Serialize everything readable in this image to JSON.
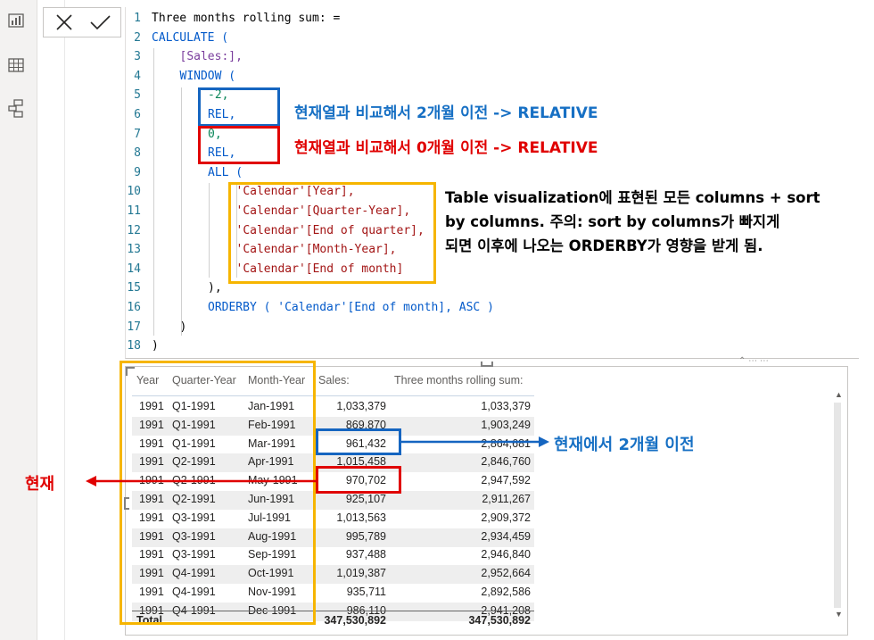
{
  "formula_bar": {
    "cancel_icon": "close-icon",
    "commit_icon": "checkmark-icon",
    "lines": [
      {
        "n": "1",
        "text": "Three months rolling sum: ="
      },
      {
        "n": "2",
        "text": "CALCULATE ("
      },
      {
        "n": "3",
        "text": "[Sales:],"
      },
      {
        "n": "4",
        "text": "WINDOW ("
      },
      {
        "n": "5",
        "text": "-2,"
      },
      {
        "n": "6",
        "text": "REL,"
      },
      {
        "n": "7",
        "text": "0,"
      },
      {
        "n": "8",
        "text": "REL,"
      },
      {
        "n": "9",
        "text": "ALL ("
      },
      {
        "n": "10",
        "text": "'Calendar'[Year],"
      },
      {
        "n": "11",
        "text": "'Calendar'[Quarter-Year],"
      },
      {
        "n": "12",
        "text": "'Calendar'[End of quarter],"
      },
      {
        "n": "13",
        "text": "'Calendar'[Month-Year],"
      },
      {
        "n": "14",
        "text": "'Calendar'[End of month]"
      },
      {
        "n": "15",
        "text": "),"
      },
      {
        "n": "16",
        "text": "ORDERBY ( 'Calendar'[End of month], ASC )"
      },
      {
        "n": "17",
        "text": ")"
      },
      {
        "n": "18",
        "text": ")"
      }
    ]
  },
  "annotations": {
    "note_minus2": "현재열과 비교해서 2개월 이전 -> RELATIVE",
    "note_zero": "현재열과 비교해서 0개월 이전 -> RELATIVE",
    "note_all_1": "Table visualization에 표현된 모든 columns + sort",
    "note_all_2": "by columns. 주의: sort by columns가 빠지게",
    "note_all_3": "되면 이후에 나오는 ORDERBY가 영향을 받게 됨.",
    "note_two_months": "현재에서 2개월 이전",
    "note_current": "현재",
    "colors": {
      "blue": "#1565c0",
      "red": "#e00000",
      "yellow": "#f6b500"
    }
  },
  "table": {
    "columns": [
      "Year",
      "Quarter-Year",
      "Month-Year",
      "Sales:",
      "Three months rolling sum:"
    ],
    "rows": [
      [
        "1991",
        "Q1-1991",
        "Jan-1991",
        "1,033,379",
        "1,033,379"
      ],
      [
        "1991",
        "Q1-1991",
        "Feb-1991",
        "869,870",
        "1,903,249"
      ],
      [
        "1991",
        "Q1-1991",
        "Mar-1991",
        "961,432",
        "2,864,681"
      ],
      [
        "1991",
        "Q2-1991",
        "Apr-1991",
        "1,015,458",
        "2,846,760"
      ],
      [
        "1991",
        "Q2-1991",
        "May-1991",
        "970,702",
        "2,947,592"
      ],
      [
        "1991",
        "Q2-1991",
        "Jun-1991",
        "925,107",
        "2,911,267"
      ],
      [
        "1991",
        "Q3-1991",
        "Jul-1991",
        "1,013,563",
        "2,909,372"
      ],
      [
        "1991",
        "Q3-1991",
        "Aug-1991",
        "995,789",
        "2,934,459"
      ],
      [
        "1991",
        "Q3-1991",
        "Sep-1991",
        "937,488",
        "2,946,840"
      ],
      [
        "1991",
        "Q4-1991",
        "Oct-1991",
        "1,019,387",
        "2,952,664"
      ],
      [
        "1991",
        "Q4-1991",
        "Nov-1991",
        "935,711",
        "2,892,586"
      ],
      [
        "1991",
        "Q4-1991",
        "Dec-1991",
        "986,110",
        "2,941,208"
      ]
    ],
    "total": {
      "label": "Total",
      "sales": "347,530,892",
      "rolling": "347,530,892"
    }
  }
}
